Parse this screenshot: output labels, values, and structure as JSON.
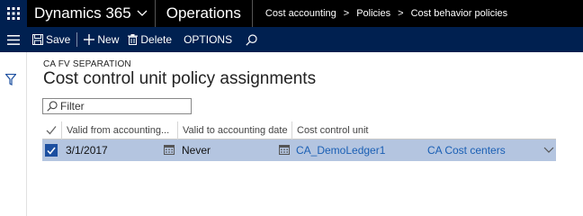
{
  "topbar": {
    "app_name": "Dynamics 365",
    "module": "Operations",
    "breadcrumb": [
      "Cost accounting",
      "Policies",
      "Cost behavior policies"
    ],
    "crumb_separator": ">"
  },
  "actions": {
    "save": "Save",
    "new": "New",
    "delete": "Delete",
    "options": "OPTIONS"
  },
  "page": {
    "caption": "CA FV SEPARATION",
    "title": "Cost control unit policy assignments"
  },
  "filter": {
    "placeholder": "Filter"
  },
  "grid": {
    "columns": [
      "Valid from accounting...",
      "Valid to accounting date",
      "Cost control unit"
    ],
    "rows": [
      {
        "selected": true,
        "valid_from": "3/1/2017",
        "valid_to": "Never",
        "cost_control_unit": "CA_DemoLedger1",
        "description": "CA Cost centers"
      }
    ]
  },
  "colors": {
    "topbar": "#000000",
    "actionbar": "#002050",
    "selected_row": "#b4c5e0",
    "link": "#1a5fb4"
  },
  "icons": [
    "waffle-icon",
    "chevron-down-icon",
    "hamburger-icon",
    "save-icon",
    "plus-icon",
    "delete-icon",
    "search-icon",
    "filter-icon",
    "checkmark-icon",
    "calendar-icon"
  ]
}
